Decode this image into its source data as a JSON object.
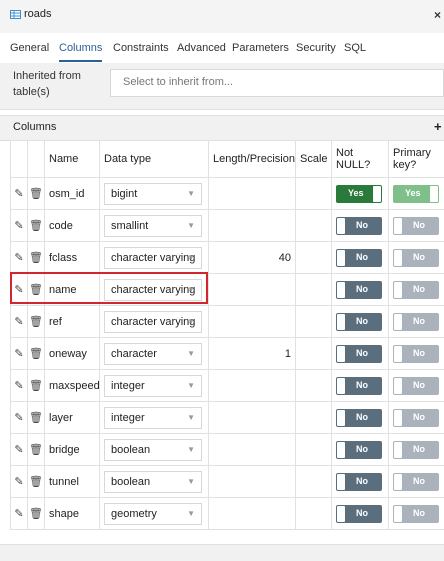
{
  "window": {
    "title": "roads",
    "close_glyph": "×",
    "title_icon": "table-icon"
  },
  "tabs": [
    {
      "label": "General",
      "active": false
    },
    {
      "label": "Columns",
      "active": true
    },
    {
      "label": "Constraints",
      "active": false
    },
    {
      "label": "Advanced",
      "active": false
    },
    {
      "label": "Parameters",
      "active": false
    },
    {
      "label": "Security",
      "active": false
    },
    {
      "label": "SQL",
      "active": false
    }
  ],
  "inherit": {
    "label": "Inherited from table(s)",
    "placeholder": "Select to inherit from..."
  },
  "columns_section": {
    "title": "Columns",
    "add_glyph": "+"
  },
  "headers": {
    "name": "Name",
    "data_type": "Data type",
    "length": "Length/Precision",
    "scale": "Scale",
    "not_null": "Not NULL?",
    "primary_key": "Primary key?"
  },
  "rows": [
    {
      "name": "osm_id",
      "data_type": "bigint",
      "length": "",
      "scale": "",
      "not_null": "Yes",
      "primary_key": "Yes"
    },
    {
      "name": "code",
      "data_type": "smallint",
      "length": "",
      "scale": "",
      "not_null": "No",
      "primary_key": "No"
    },
    {
      "name": "fclass",
      "data_type": "character varying",
      "length": "40",
      "scale": "",
      "not_null": "No",
      "primary_key": "No"
    },
    {
      "name": "name",
      "data_type": "character varying",
      "length": "",
      "scale": "",
      "not_null": "No",
      "primary_key": "No"
    },
    {
      "name": "ref",
      "data_type": "character varying",
      "length": "",
      "scale": "",
      "not_null": "No",
      "primary_key": "No"
    },
    {
      "name": "oneway",
      "data_type": "character",
      "length": "1",
      "scale": "",
      "not_null": "No",
      "primary_key": "No"
    },
    {
      "name": "maxspeed",
      "data_type": "integer",
      "length": "",
      "scale": "",
      "not_null": "No",
      "primary_key": "No"
    },
    {
      "name": "layer",
      "data_type": "integer",
      "length": "",
      "scale": "",
      "not_null": "No",
      "primary_key": "No"
    },
    {
      "name": "bridge",
      "data_type": "boolean",
      "length": "",
      "scale": "",
      "not_null": "No",
      "primary_key": "No"
    },
    {
      "name": "tunnel",
      "data_type": "boolean",
      "length": "",
      "scale": "",
      "not_null": "No",
      "primary_key": "No"
    },
    {
      "name": "shape",
      "data_type": "geometry",
      "length": "",
      "scale": "",
      "not_null": "No",
      "primary_key": "No"
    }
  ],
  "colors": {
    "active_tab": "#2c5f98",
    "toggle_yes": "#2a7a3b",
    "toggle_no": "#5a6e7e",
    "highlight": "#d0272e"
  }
}
